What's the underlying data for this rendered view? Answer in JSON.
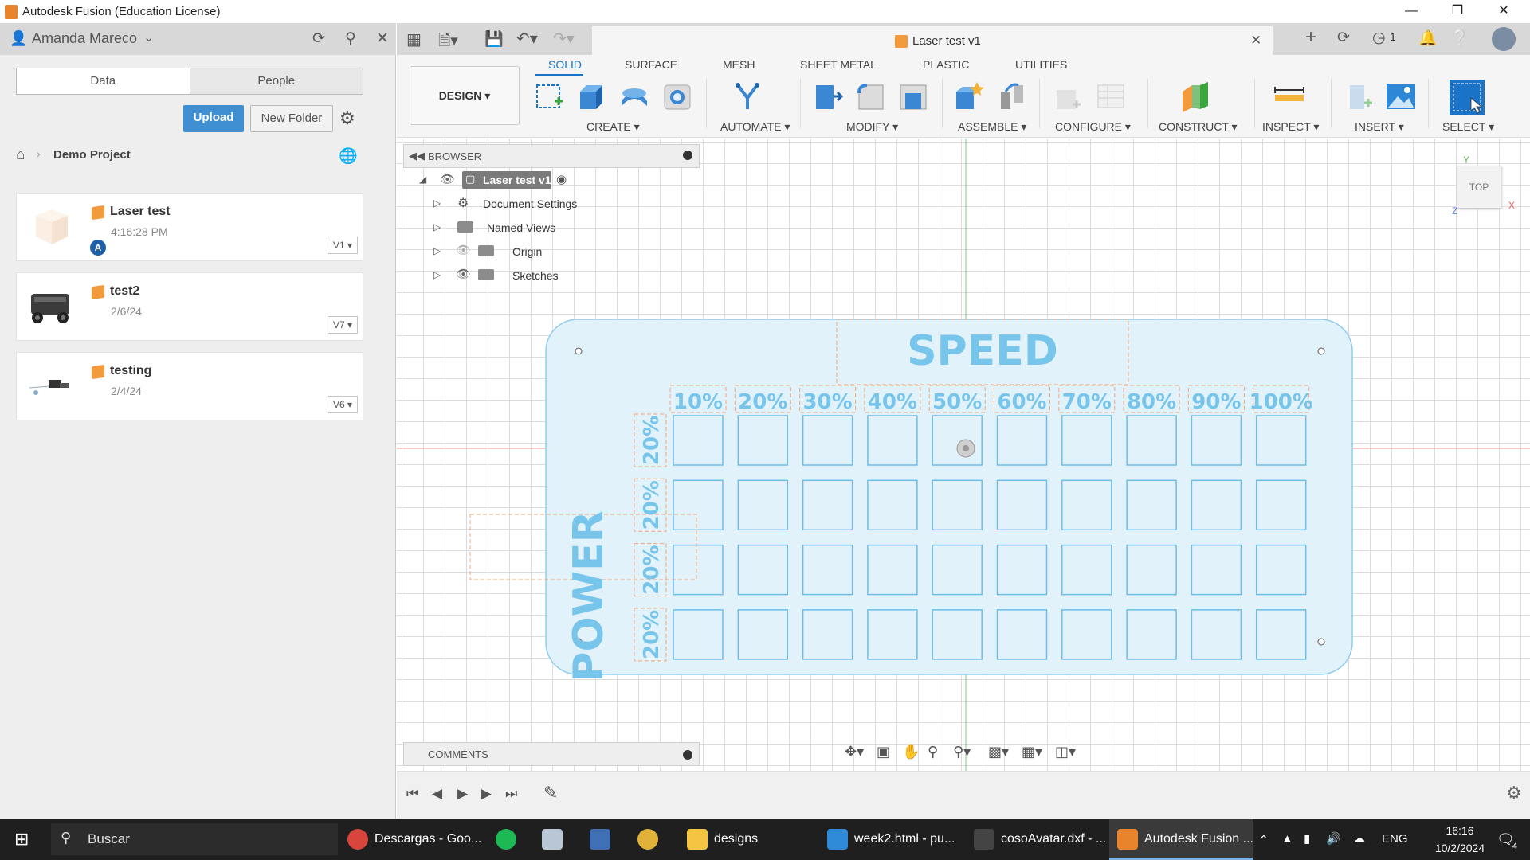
{
  "window": {
    "title": "Autodesk Fusion (Education License)"
  },
  "data_panel": {
    "user_name": "Amanda Mareco",
    "tabs": [
      "Data",
      "People"
    ],
    "upload_label": "Upload",
    "new_folder_label": "New Folder",
    "breadcrumb": "Demo Project",
    "files": [
      {
        "name": "Laser test",
        "date": "4:16:28 PM",
        "version": "V1",
        "badge": "A"
      },
      {
        "name": "test2",
        "date": "2/6/24",
        "version": "V7"
      },
      {
        "name": "testing",
        "date": "2/4/24",
        "version": "V6"
      }
    ]
  },
  "document": {
    "tab_title": "Laser test v1",
    "notifications_count": "1"
  },
  "toolbar": {
    "workspace_label": "DESIGN",
    "workspace_tabs": [
      "SOLID",
      "SURFACE",
      "MESH",
      "SHEET METAL",
      "PLASTIC",
      "UTILITIES"
    ],
    "groups": [
      "CREATE",
      "AUTOMATE",
      "MODIFY",
      "ASSEMBLE",
      "CONFIGURE",
      "CONSTRUCT",
      "INSPECT",
      "INSERT",
      "SELECT"
    ]
  },
  "browser": {
    "header": "BROWSER",
    "root": "Laser test v1",
    "items": [
      "Document Settings",
      "Named Views",
      "Origin",
      "Sketches"
    ]
  },
  "comments": {
    "header": "COMMENTS"
  },
  "viewcube": {
    "label": "TOP",
    "axis_x": "X",
    "axis_y": "Y",
    "axis_z": "Z"
  },
  "sketch": {
    "speed_title": "SPEED",
    "power_title": "POWER",
    "speed_columns": [
      "10%",
      "20%",
      "30%",
      "40%",
      "50%",
      "60%",
      "70%",
      "80%",
      "90%",
      "100%"
    ],
    "power_rows": [
      "20%",
      "20%",
      "20%",
      "20%"
    ]
  },
  "taskbar": {
    "search_placeholder": "Buscar",
    "items": [
      "Descargas - Goo...",
      "designs",
      "week2.html - pu...",
      "cosoAvatar.dxf - ...",
      "Autodesk Fusion ..."
    ],
    "language": "ENG",
    "time": "16:16",
    "date": "10/2/2024",
    "notification_count": "4"
  },
  "colors": {
    "accent": "#1a73c7",
    "sketch_blue": "#78c5ec",
    "sketch_fill": "#e2f2fb",
    "orange": "#f29a3c"
  }
}
